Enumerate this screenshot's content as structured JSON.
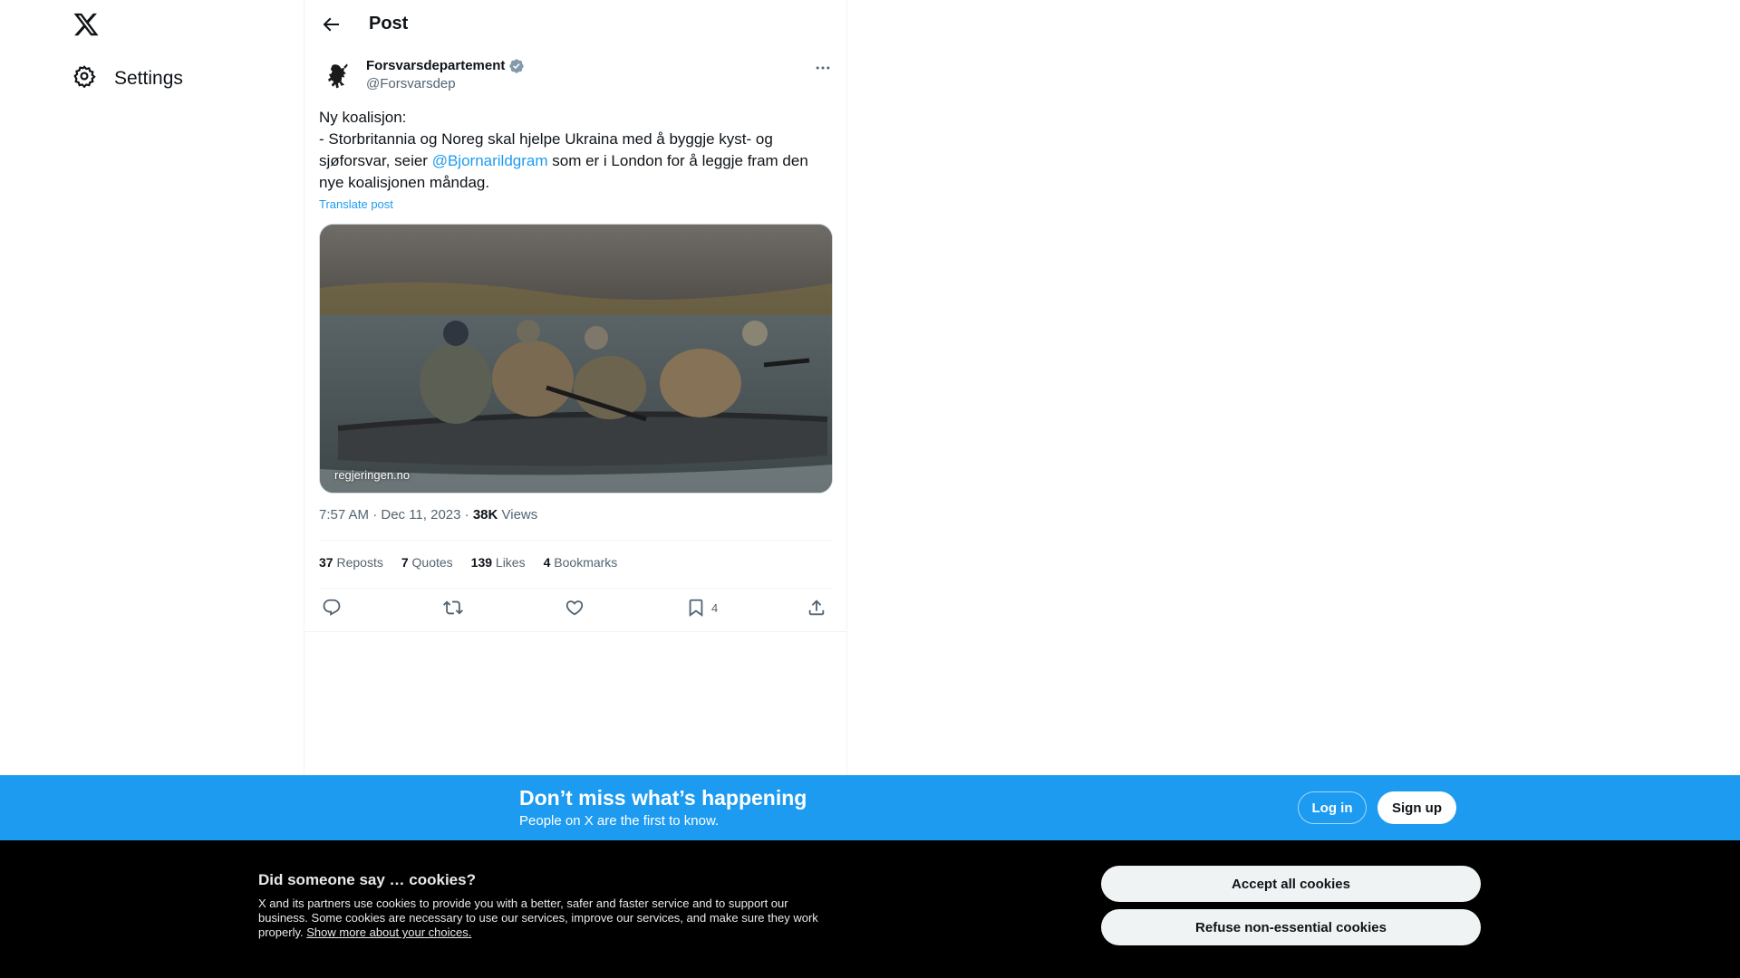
{
  "sidebar": {
    "settings_label": "Settings"
  },
  "header": {
    "title": "Post"
  },
  "post": {
    "display_name": "Forsvarsdepartement",
    "handle": "@Forsvarsdep",
    "text_line1": "Ny koalisjon:",
    "text_line2_before": "- Storbritannia og Noreg skal hjelpe Ukraina med å byggje kyst- og sjøforsvar, seier ",
    "mention": "@Bjornarildgram",
    "text_line2_after": " som er i London for å leggje fram den nye koalisjonen måndag.",
    "translate": "Translate post",
    "media_source": "regjeringen.no",
    "time": "7:57 AM · Dec 11, 2023 · ",
    "views_count": "38K",
    "views_label": " Views",
    "reposts_count": "37",
    "reposts_label": "Reposts",
    "quotes_count": "7",
    "quotes_label": "Quotes",
    "likes_count": "139",
    "likes_label": "Likes",
    "bookmarks_count": "4",
    "bookmarks_label": "Bookmarks",
    "bookmark_action_count": "4"
  },
  "banner": {
    "heading": "Don’t miss what’s happening",
    "sub": "People on X are the first to know.",
    "login": "Log in",
    "signup": "Sign up"
  },
  "cookies": {
    "heading": "Did someone say … cookies?",
    "body": "X and its partners use cookies to provide you with a better, safer and faster service and to support our business. Some cookies are necessary to use our services, improve our services, and make sure they work properly. ",
    "link": "Show more about your choices.",
    "accept": "Accept all cookies",
    "refuse": "Refuse non-essential cookies"
  },
  "colors": {
    "accent": "#1d9bf0",
    "verified": "#829aab"
  }
}
